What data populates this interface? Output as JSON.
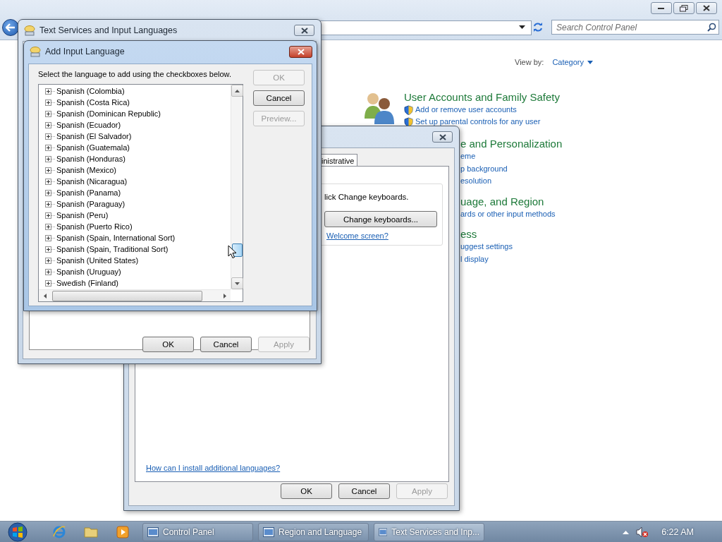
{
  "control_panel": {
    "search": {
      "placeholder": "Search Control Panel"
    },
    "view_by": {
      "label": "View by:",
      "value": "Category"
    },
    "categories": [
      {
        "title": "User Accounts and Family Safety",
        "links": [
          "Add or remove user accounts",
          "Set up parental controls for any user"
        ]
      }
    ],
    "clipped_categories": [
      {
        "title": "e and Personalization",
        "links": [
          "eme",
          "p background",
          "esolution"
        ]
      },
      {
        "title": "uage, and Region",
        "links": [
          "ards or other input methods"
        ]
      },
      {
        "title": "ess",
        "links": [
          "uggest settings",
          "l display"
        ]
      }
    ]
  },
  "region_window": {
    "tab": "inistrative",
    "instruction": "lick Change keyboards.",
    "change_button": "Change keyboards...",
    "welcome_link": "Welcome screen?",
    "install_link": "How can I install additional languages?",
    "buttons": [
      {
        "label": "OK",
        "disabled": false
      },
      {
        "label": "Cancel",
        "disabled": false
      },
      {
        "label": "Apply",
        "disabled": true
      }
    ]
  },
  "text_services_window": {
    "title": "Text Services and Input Languages",
    "buttons": [
      {
        "label": "OK",
        "disabled": false
      },
      {
        "label": "Cancel",
        "disabled": false
      },
      {
        "label": "Apply",
        "disabled": true
      }
    ]
  },
  "add_language_dialog": {
    "title": "Add Input Language",
    "instruction": "Select the language to add using the checkboxes below.",
    "buttons": [
      {
        "label": "OK",
        "disabled": true
      },
      {
        "label": "Cancel",
        "disabled": false
      },
      {
        "label": "Preview...",
        "disabled": true
      }
    ],
    "languages": [
      {
        "label": "Spanish (Colombia)",
        "expanded": false
      },
      {
        "label": "Spanish (Costa Rica)",
        "expanded": false
      },
      {
        "label": "Spanish (Dominican Republic)",
        "expanded": false
      },
      {
        "label": "Spanish (Ecuador)",
        "expanded": false
      },
      {
        "label": "Spanish (El Salvador)",
        "expanded": false
      },
      {
        "label": "Spanish (Guatemala)",
        "expanded": false
      },
      {
        "label": "Spanish (Honduras)",
        "expanded": false
      },
      {
        "label": "Spanish (Mexico)",
        "expanded": false
      },
      {
        "label": "Spanish (Nicaragua)",
        "expanded": false
      },
      {
        "label": "Spanish (Panama)",
        "expanded": false
      },
      {
        "label": "Spanish (Paraguay)",
        "expanded": false
      },
      {
        "label": "Spanish (Peru)",
        "expanded": false
      },
      {
        "label": "Spanish (Puerto Rico)",
        "expanded": false
      },
      {
        "label": "Spanish (Spain, International Sort)",
        "expanded": false
      },
      {
        "label": "Spanish (Spain, Traditional Sort)",
        "expanded": false
      },
      {
        "label": "Spanish (United States)",
        "expanded": false
      },
      {
        "label": "Spanish (Uruguay)",
        "expanded": false
      },
      {
        "label": "Swedish (Finland)",
        "expanded": false
      }
    ]
  },
  "taskbar": {
    "tasks": [
      {
        "label": "Control Panel",
        "selected": false
      },
      {
        "label": "Region and Language",
        "selected": false
      },
      {
        "label": "Text Services and Inp...",
        "selected": true
      }
    ],
    "clock": "6:22 AM"
  }
}
